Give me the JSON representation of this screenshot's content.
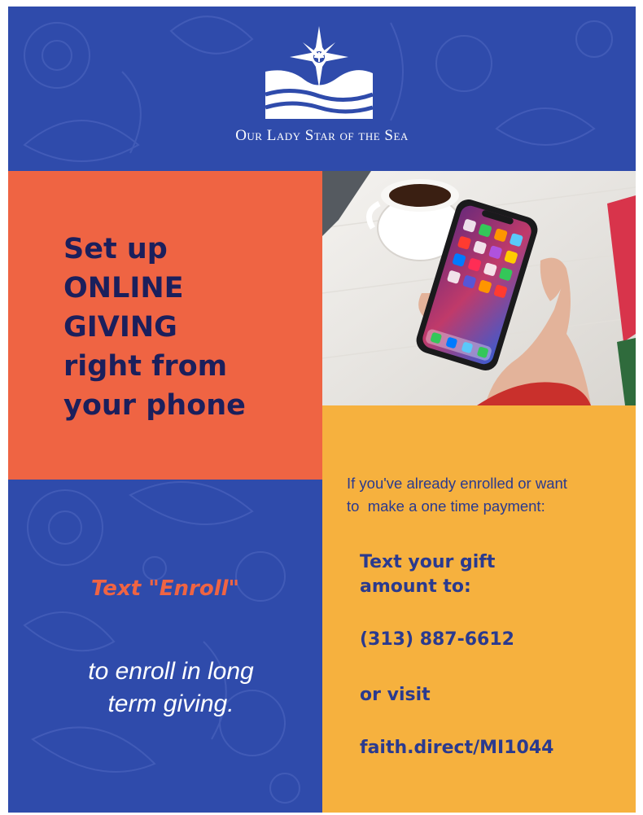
{
  "header": {
    "parish_name": "Our Lady Star of the Sea",
    "logo_icon": "star-over-waves-icon"
  },
  "headline": {
    "lines": [
      "Set up",
      "ONLINE",
      "GIVING",
      "right from",
      "your phone"
    ]
  },
  "photo": {
    "icon": "hand-holding-phone-photo"
  },
  "enroll": {
    "title": "Text \"Enroll\"",
    "subtitle_line1": "to enroll in long",
    "subtitle_line2": "term giving."
  },
  "payment": {
    "intro_line1": "If you've already enrolled or want",
    "intro_line2": "to  make a one time payment:",
    "text_gift_line1": "Text your gift",
    "text_gift_line2": "amount to:",
    "phone": "(313) 887-6612",
    "or_visit": "or visit",
    "url": "faith.direct/MI1044"
  },
  "colors": {
    "blue": "#2f4bab",
    "orange": "#ef6443",
    "yellow": "#f6b13e",
    "navy": "#1b1f5c"
  }
}
